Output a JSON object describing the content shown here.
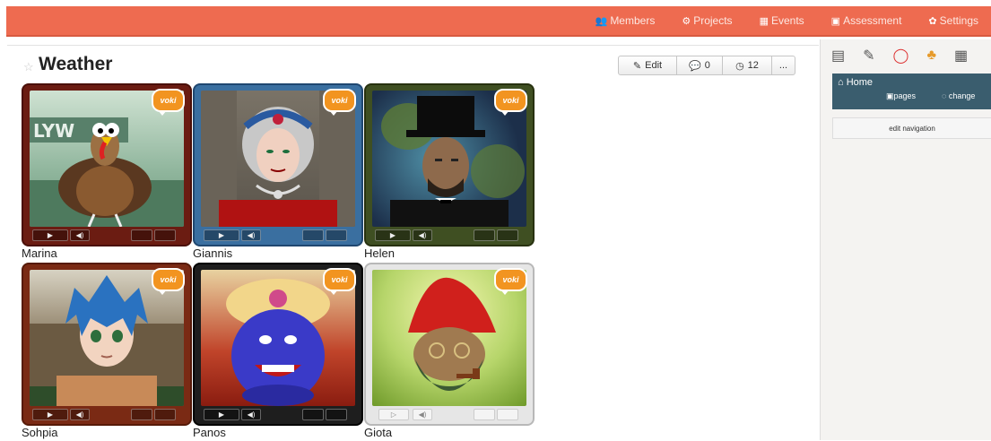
{
  "nav": {
    "items": [
      {
        "label": "Members",
        "icon": "members-icon"
      },
      {
        "label": "Projects",
        "icon": "projects-icon"
      },
      {
        "label": "Events",
        "icon": "calendar-icon"
      },
      {
        "label": "Assessment",
        "icon": "assessment-icon"
      },
      {
        "label": "Settings",
        "icon": "gear-icon"
      }
    ]
  },
  "page": {
    "title": "Weather",
    "edit_label": "Edit",
    "comments_count": "0",
    "history_count": "12",
    "more_label": "..."
  },
  "avatars": [
    {
      "name": "Marina",
      "theme": "turkey",
      "frame_color": "#6b1c12"
    },
    {
      "name": "Giannis",
      "theme": "queen",
      "frame_color": "#3a6fa0"
    },
    {
      "name": "Helen",
      "theme": "president",
      "frame_color": "#3f4f22"
    },
    {
      "name": "Sohpia",
      "theme": "anime",
      "frame_color": "#7a2a14"
    },
    {
      "name": "Panos",
      "theme": "genie",
      "frame_color": "#1e1e1e"
    },
    {
      "name": "Giota",
      "theme": "gnome",
      "frame_color": "#d8d8d8"
    }
  ],
  "voki_label": "voki",
  "sidebar": {
    "home_label": "Home",
    "pages_label": "pages",
    "changes_label": "change",
    "edit_navigation_label": "edit navigation"
  },
  "colors": {
    "topbar": "#ee6b50",
    "home_panel": "#3a5d6e"
  }
}
